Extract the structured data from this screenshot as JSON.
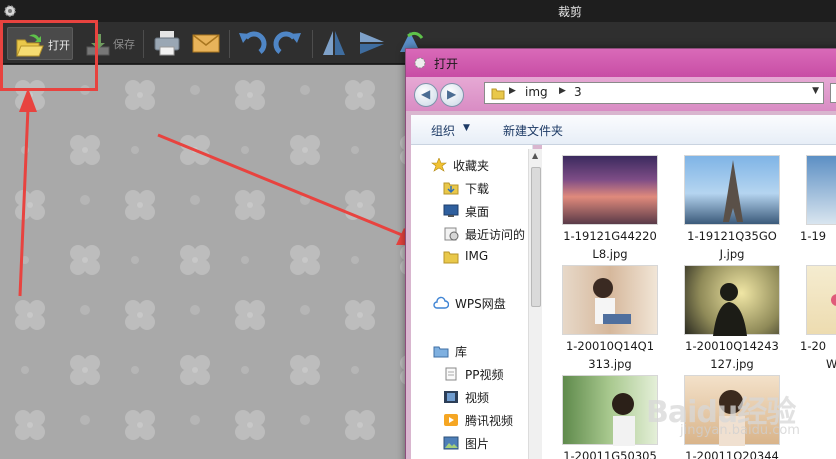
{
  "app": {
    "title": "裁剪"
  },
  "toolbar": {
    "open_label": "打开",
    "save_label": "保存"
  },
  "dialog": {
    "title": "打开",
    "breadcrumb": [
      "img",
      "3"
    ],
    "commands": {
      "organize": "组织",
      "new_folder": "新建文件夹"
    },
    "nav": {
      "favorites": "收藏夹",
      "downloads": "下载",
      "desktop": "桌面",
      "recent": "最近访问的",
      "img": "IMG",
      "wps": "WPS网盘",
      "libraries": "库",
      "pp_video": "PP视频",
      "video": "视频",
      "tencent_video": "腾讯视频",
      "pictures": "图片"
    },
    "files": [
      {
        "line1": "1-19121G44220",
        "line2": "L8.jpg"
      },
      {
        "line1": "1-19121Q35GO",
        "line2": "J.jpg"
      },
      {
        "line1": "1-19",
        "line2": ""
      },
      {
        "line1": "1-20010Q14Q1",
        "line2": "313.jpg"
      },
      {
        "line1": "1-20010Q14243",
        "line2": "127.jpg"
      },
      {
        "line1": "1-20",
        "line2": "W"
      },
      {
        "line1": "1-20011G50305",
        "line2": ""
      },
      {
        "line1": "1-20011Q20344",
        "line2": ""
      }
    ]
  },
  "watermark": {
    "brand": "Baidu经验",
    "url": "jingyan.baidu.com"
  },
  "colors": {
    "annotation": "#e8433f",
    "dialog_title": "#d96ab8",
    "canvas": "#a9a9a9"
  }
}
